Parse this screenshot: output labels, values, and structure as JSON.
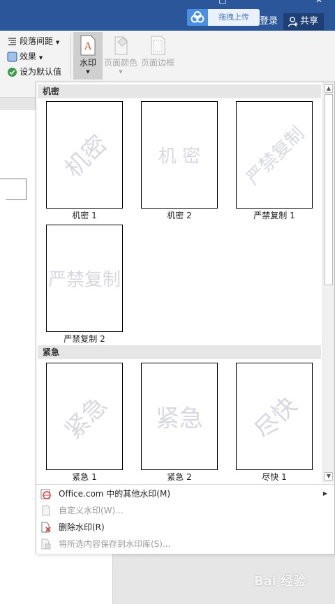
{
  "window": {
    "controls": {
      "restore": "□",
      "close": "✕"
    }
  },
  "header": {
    "upload_label": "拖拽上传",
    "login": "登录",
    "share": "共享"
  },
  "ribbon": {
    "paragraph_spacing": "段落间距",
    "effects": "效果",
    "set_default": "设为默认值",
    "watermark": "水印",
    "page_color": "页面颜色",
    "page_border": "页面边框",
    "dropdown_arrow": "▼"
  },
  "gallery": {
    "sections": [
      {
        "header": "机密",
        "items": [
          {
            "watermark_text": "机密",
            "label": "机密 1",
            "style": "diagonal"
          },
          {
            "watermark_text": "机 密",
            "label": "机密 2",
            "style": "horizontal"
          },
          {
            "watermark_text": "严禁复制",
            "label": "严禁复制 1",
            "style": "diagonal"
          },
          {
            "watermark_text": "严禁复制",
            "label": "严禁复制 2",
            "style": "horizontal"
          }
        ]
      },
      {
        "header": "紧急",
        "items": [
          {
            "watermark_text": "紧急",
            "label": "紧急 1",
            "style": "diagonal"
          },
          {
            "watermark_text": "紧急",
            "label": "紧急 2",
            "style": "horizontal"
          },
          {
            "watermark_text": "尽快",
            "label": "尽快 1",
            "style": "diagonal"
          }
        ]
      }
    ],
    "scroll_up": "▲",
    "scroll_down": "▼"
  },
  "menu": {
    "items": [
      {
        "label": "Office.com 中的其他水印(M)",
        "enabled": true,
        "icon": "office-watermark-icon",
        "submenu": true
      },
      {
        "label": "自定义水印(W)...",
        "enabled": false,
        "icon": "custom-watermark-icon"
      },
      {
        "label": "删除水印(R)",
        "enabled": true,
        "icon": "remove-watermark-icon"
      },
      {
        "label": "将所选内容保存到水印库(S)...",
        "enabled": false,
        "icon": "save-watermark-icon"
      }
    ],
    "submenu_arrow": "▶"
  },
  "overlay": {
    "baidu": "Bai 经验"
  },
  "colors": {
    "title_bar": "#2b579a",
    "ribbon_bg": "#f3f3f3",
    "watermark_text": "#d8d8e2",
    "section_header": "#e6e6e6",
    "delete_icon_red": "#d13438"
  }
}
